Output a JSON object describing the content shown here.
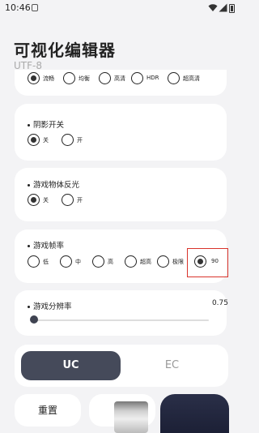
{
  "status": {
    "time": "10:46"
  },
  "header": {
    "title": "可视化编辑器",
    "subtitle": "UTF-8"
  },
  "quality": {
    "options": [
      "流畅",
      "均衡",
      "高清",
      "HDR",
      "超高清"
    ],
    "selected": 0
  },
  "shadow": {
    "title": "阴影开关",
    "options": [
      "关",
      "开"
    ],
    "selected": 0
  },
  "reflection": {
    "title": "游戏物体反光",
    "options": [
      "关",
      "开"
    ],
    "selected": 0
  },
  "framerate": {
    "title": "游戏帧率",
    "options": [
      "低",
      "中",
      "高",
      "超高",
      "极限",
      "90"
    ],
    "selected": 5
  },
  "resolution": {
    "title": "游戏分辨率",
    "value": "0.75",
    "fill_fraction": 0.0
  },
  "mode": {
    "uc_label": "UC",
    "ec_label": "EC"
  },
  "actions": {
    "reset_label": "重置"
  }
}
